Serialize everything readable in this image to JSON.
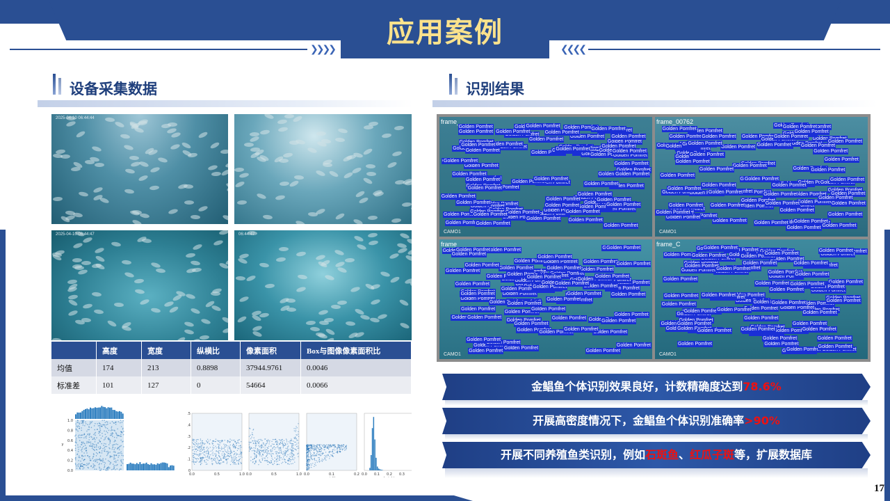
{
  "title": "应用案例",
  "page_number": "17",
  "left_section": {
    "title": "设备采集数据"
  },
  "right_section": {
    "title": "识别结果"
  },
  "photos": [
    {
      "timestamp": "2025-04-10 06:44:44"
    },
    {
      "timestamp": ""
    },
    {
      "timestamp": "2025-04-10 06:44:47"
    },
    {
      "timestamp": "06:44:47"
    }
  ],
  "table": {
    "headers": [
      "",
      "高度",
      "宽度",
      "纵横比",
      "像素面积",
      "Box与图像像素面积比"
    ],
    "rows": [
      [
        "均值",
        "174",
        "213",
        "0.8898",
        "37944.9761",
        "0.0046"
      ],
      [
        "标准差",
        "101",
        "127",
        "0",
        "54664",
        "0.0066"
      ]
    ]
  },
  "result_frames": [
    {
      "frame": "frame_",
      "cam": "CAMO1"
    },
    {
      "frame": "frame_00762",
      "cam": "CAMO1"
    },
    {
      "frame": "frame",
      "cam": "CAMO1"
    },
    {
      "frame": "frame_C",
      "cam": "CAMO1"
    }
  ],
  "detection_label": "Golden Pomfret",
  "banners": [
    {
      "text": "金鲳鱼个体识别效果良好，计数精确度达到",
      "highlight": "78.6%"
    },
    {
      "text": "开展高密度情况下，金鲳鱼个体识别准确率",
      "highlight": ">90%"
    },
    {
      "pre": "开展不同养殖鱼类识别，例如",
      "h1": "石斑鱼",
      "sep": "、",
      "h2": "红瓜子斑",
      "post": "等，扩展数据库"
    }
  ],
  "chart_data": [
    {
      "type": "scatter",
      "xlabel": "",
      "ylabel": "y",
      "x_ticks": [],
      "y_ticks": [
        "0.0",
        "0.2",
        "0.4",
        "0.6",
        "0.8",
        "1.0"
      ]
    },
    {
      "type": "scatter",
      "xlabel": "x",
      "ylabel": "",
      "x_ticks": [
        "0.0",
        "0.5",
        "1.0"
      ],
      "y_ticks": [
        "0",
        ".1",
        ".2",
        ".3",
        ".4",
        ".5"
      ]
    },
    {
      "type": "scatter",
      "xlabel": "y",
      "ylabel": "",
      "x_ticks": [
        "0.0",
        "0.5",
        "1.0"
      ],
      "y_ticks": []
    },
    {
      "type": "scatter",
      "xlabel": "width",
      "ylabel": "",
      "x_ticks": [
        "0.0",
        "0.1",
        "0.2"
      ],
      "y_ticks": []
    },
    {
      "type": "bar",
      "xlabel": "height",
      "ylabel": "",
      "x_ticks": [
        "0.0",
        "0.1",
        "0.2",
        "0.3",
        "0.4"
      ],
      "y_ticks": []
    }
  ]
}
